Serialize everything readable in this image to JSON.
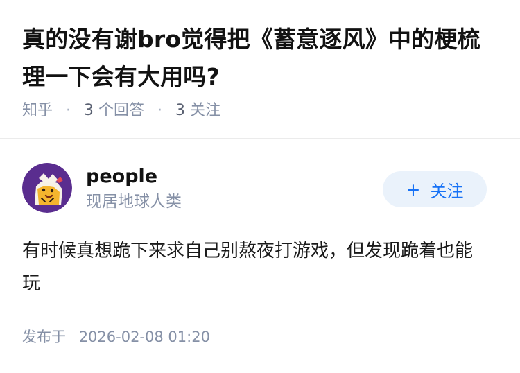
{
  "question": {
    "title": "真的没有谢bro觉得把《蓄意逐风》中的梗梳理一下会有大用吗?",
    "source": "知乎",
    "answer_count": "3",
    "answer_label": "个回答",
    "follow_count": "3",
    "follow_label": "关注"
  },
  "answer": {
    "author_name": "people",
    "author_bio": "现居地球人类",
    "follow_button": {
      "icon": "plus-icon",
      "label": "关注",
      "plus": "+"
    },
    "content": "有时候真想跪下来求自己别熬夜打游戏，但发现跪着也能玩",
    "published_label": "发布于",
    "published_time": "2026-02-08 01:20"
  },
  "colors": {
    "title": "#121212",
    "meta": "#8590a6",
    "accent": "#1772f6",
    "follow_bg": "#eaf2fb",
    "divider": "#ebebeb",
    "avatar_bg": "#5a2d8f",
    "avatar_character": "#f4b52e"
  }
}
